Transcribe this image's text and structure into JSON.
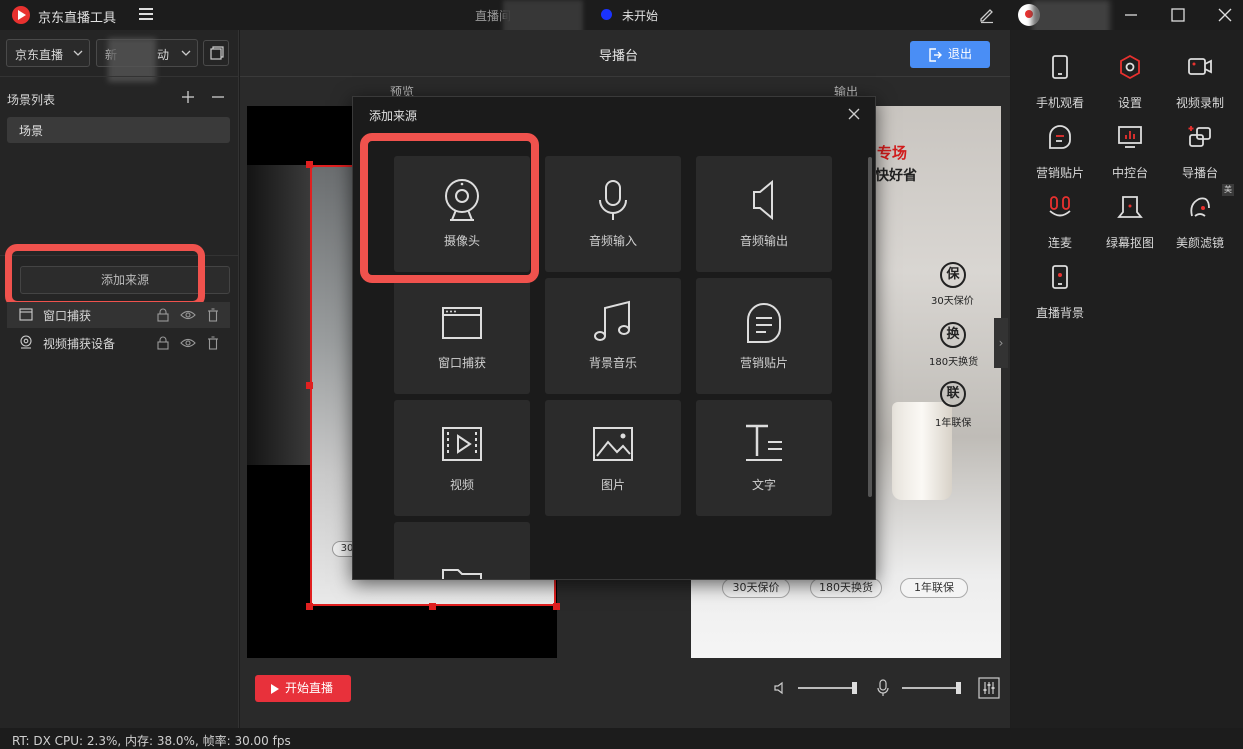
{
  "titlebar": {
    "app_title": "京东直播工具",
    "center_title": "直播间",
    "status": "未开始",
    "status_color": "#1a33ff"
  },
  "left": {
    "select1": "京东直播",
    "select2": "新",
    "select2_suffix": "动",
    "scene_list_title": "场景列表",
    "scene_item": "场景",
    "add_source": "添加来源",
    "sources": [
      {
        "label": "窗口捕获",
        "icon": "window-icon"
      },
      {
        "label": "视频捕获设备",
        "icon": "camera-icon"
      }
    ]
  },
  "main": {
    "title": "导播台",
    "exit": "退出",
    "preview_label": "预览",
    "output_label": "输出",
    "start_live": "开始直播"
  },
  "output_content": {
    "promo_line1": "专场",
    "promo_line2": "快好省",
    "badges": [
      {
        "char": "保",
        "text": "30天保价"
      },
      {
        "char": "换",
        "text": "180天换货"
      },
      {
        "char": "联",
        "text": "1年联保"
      }
    ],
    "pills": [
      "30天保价",
      "180天换货",
      "1年联保"
    ],
    "preview_pill": "30"
  },
  "dialog": {
    "title": "添加来源",
    "tiles": [
      {
        "label": "摄像头",
        "icon": "webcam-icon"
      },
      {
        "label": "音频输入",
        "icon": "microphone-icon"
      },
      {
        "label": "音频输出",
        "icon": "speaker-icon"
      },
      {
        "label": "窗口捕获",
        "icon": "window-capture-icon"
      },
      {
        "label": "背景音乐",
        "icon": "music-note-icon"
      },
      {
        "label": "营销贴片",
        "icon": "sticker-icon"
      },
      {
        "label": "视频",
        "icon": "video-play-icon"
      },
      {
        "label": "图片",
        "icon": "image-icon"
      },
      {
        "label": "文字",
        "icon": "text-icon"
      },
      {
        "label": "",
        "icon": "folder-icon"
      }
    ]
  },
  "right_tools": [
    {
      "label": "手机观看",
      "icon": "phone-icon"
    },
    {
      "label": "设置",
      "icon": "settings-icon"
    },
    {
      "label": "视频录制",
      "icon": "video-record-icon"
    },
    {
      "label": "营销贴片",
      "icon": "sticker-icon"
    },
    {
      "label": "中控台",
      "icon": "dashboard-icon"
    },
    {
      "label": "导播台",
      "icon": "director-icon"
    },
    {
      "label": "连麦",
      "icon": "co-host-icon"
    },
    {
      "label": "绿幕抠图",
      "icon": "green-screen-icon"
    },
    {
      "label": "美颜滤镜",
      "icon": "beauty-filter-icon"
    },
    {
      "label": "直播背景",
      "icon": "live-background-icon"
    }
  ],
  "beauty_badge": "美",
  "statusbar": {
    "text": "RT: DX CPU: 2.3%, 内存: 38.0%, 帧率: 30.00 fps"
  },
  "colors": {
    "accent_blue": "#4a8ef5",
    "start_red": "#e8313b",
    "highlight": "#f0524d"
  }
}
